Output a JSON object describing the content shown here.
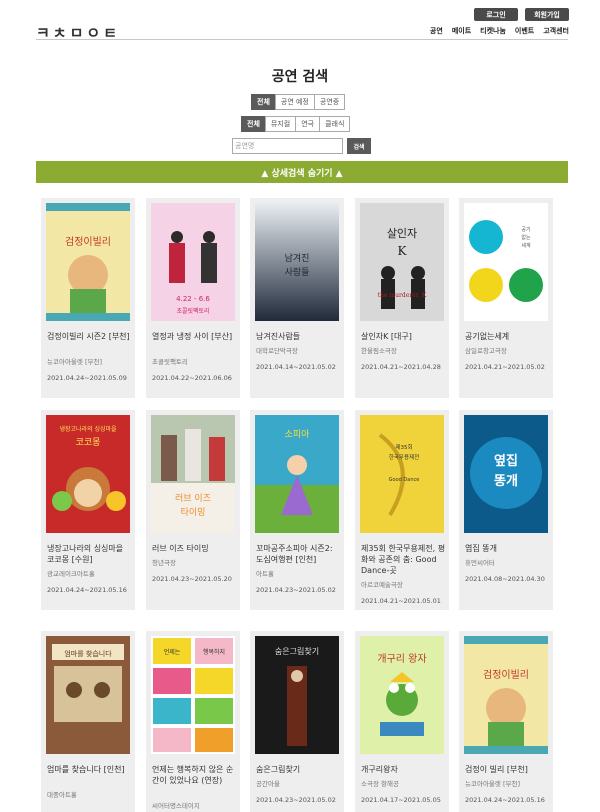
{
  "header": {
    "login": "로그인",
    "signup": "회원가입",
    "logo": "ㅋㅊㅁㅇㅌ",
    "nav": [
      "공연",
      "메이트",
      "티켓나눔",
      "이벤트",
      "고객센터"
    ]
  },
  "page_title": "공연 검색",
  "filters": {
    "status": [
      {
        "label": "전체",
        "active": true
      },
      {
        "label": "공연 예정",
        "active": false
      },
      {
        "label": "공연중",
        "active": false
      }
    ],
    "genre": [
      {
        "label": "전체",
        "active": true
      },
      {
        "label": "뮤지컬",
        "active": false
      },
      {
        "label": "연극",
        "active": false
      },
      {
        "label": "클래식",
        "active": false
      }
    ]
  },
  "search": {
    "placeholder": "공연명",
    "button": "검색"
  },
  "advanced_toggle": "▲ 상세검색 숨기기 ▲",
  "cards": [
    {
      "title": "검정이빌리 시즌2 [부천]",
      "venue": "뉴코아아울렛 [부천]",
      "date": "2021.04.24~2021.05.09"
    },
    {
      "title": "열정과 냉정 사이 [부산]",
      "venue": "초콜릿팩토리",
      "date": "2021.04.22~2021.06.06"
    },
    {
      "title": "남겨진사람들",
      "venue": "대학로단막극장",
      "date": "2021.04.14~2021.05.02"
    },
    {
      "title": "살인자K [대구]",
      "venue": "한울림소극장",
      "date": "2021.04.21~2021.04.28"
    },
    {
      "title": "공기없는세계",
      "venue": "삼일로창고극장",
      "date": "2021.04.21~2021.05.02"
    },
    {
      "title": "냉장고나라의 싱싱마을 코코몽 [수원]",
      "venue": "광교레이크아트홀",
      "date": "2021.04.24~2021.05.16"
    },
    {
      "title": "러브 이즈 타이밍",
      "venue": "청년극장",
      "date": "2021.04.23~2021.05.20"
    },
    {
      "title": "꼬마공주소피아 시즌2: 도심여행편 [인천]",
      "venue": "아트홀",
      "date": "2021.04.23~2021.05.02"
    },
    {
      "title": "제35회 한국무용제전, 평화와 공존의 춤: Good Dance-곳",
      "venue": "아르코예술극장",
      "date": "2021.04.21~2021.05.01"
    },
    {
      "title": "엽집 똥개",
      "venue": "휴먼씨어터",
      "date": "2021.04.08~2021.04.30"
    },
    {
      "title": "엄마를 찾습니다 [인천]",
      "venue": "대중아트홀",
      "date": ""
    },
    {
      "title": "언제는 행복하지 않은 순간이 있었나요 (연장)",
      "venue": "씨어터명스테이지",
      "date": ""
    },
    {
      "title": "숨은그림찾기",
      "venue": "공간아울",
      "date": "2021.04.23~2021.05.02"
    },
    {
      "title": "개구리왕자",
      "venue": "소극장 항해공",
      "date": "2021.04.17~2021.05.05"
    },
    {
      "title": "검정이 빌리 [부천]",
      "venue": "뉴코아아울렛 [부천]",
      "date": "2021.04.24~2021.05.16"
    }
  ],
  "posters": [
    {
      "text": "검정이빌리",
      "style": "bill"
    },
    {
      "text": "4.22 - 6.6  초콜릿팩토리",
      "style": "pink"
    },
    {
      "text": "남겨진 사람들",
      "style": "dark"
    },
    {
      "text": "살인자 K  the murderer, K",
      "style": "grey"
    },
    {
      "text": "공기 없는 세계",
      "style": "circles"
    },
    {
      "text": "냉장고나라의 싱싱마을 코코몽",
      "style": "kids"
    },
    {
      "text": "러브 이즈 타이밍",
      "style": "love"
    },
    {
      "text": "소피아",
      "style": "sofia"
    },
    {
      "text": "제35회 한국무용제전",
      "style": "dance"
    },
    {
      "text": "옆집 똥개",
      "style": "dog"
    },
    {
      "text": "엄마를 찾습니다",
      "style": "mom"
    },
    {
      "text": "언제는 행복하지 않은 순간이",
      "style": "tiles"
    },
    {
      "text": "숨은그림찾기",
      "style": "hidden"
    },
    {
      "text": "개구리 왕자",
      "style": "frog"
    },
    {
      "text": "검정이빌리",
      "style": "bill"
    }
  ]
}
